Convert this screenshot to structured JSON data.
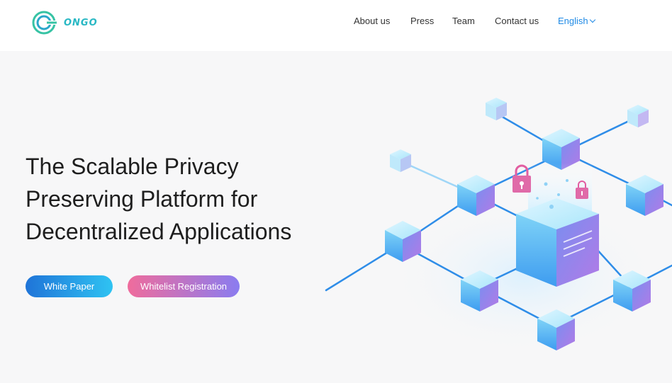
{
  "header": {
    "logo_text": "ONGO",
    "nav": [
      {
        "label": "About us"
      },
      {
        "label": "Press"
      },
      {
        "label": "Team"
      },
      {
        "label": "Contact us"
      }
    ],
    "language": "English"
  },
  "hero": {
    "title_lines": [
      "The Scalable Privacy",
      "Preserving Platform for",
      "Decentralized Applications"
    ],
    "buttons": {
      "white_paper": "White Paper",
      "whitelist": "Whitelist Registration"
    }
  },
  "colors": {
    "accent_blue": "#1f8ae5",
    "logo_teal": "#29b8c4",
    "pink": "#ef6c9c",
    "purple": "#8a7cf0"
  }
}
